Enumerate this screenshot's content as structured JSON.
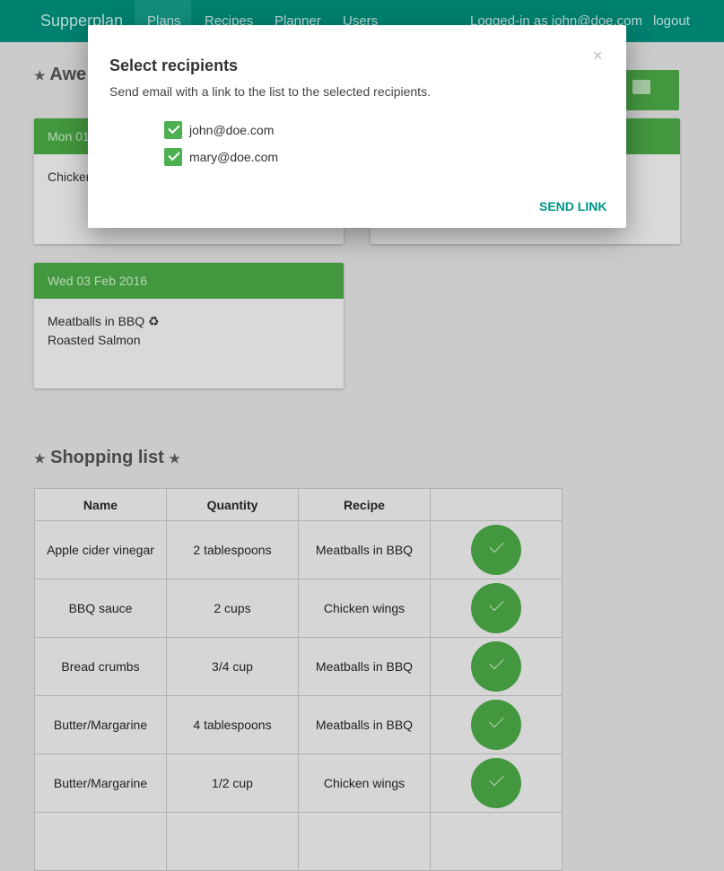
{
  "nav": {
    "brand": "Supperplan",
    "items": [
      "Plans",
      "Recipes",
      "Planner",
      "Users"
    ],
    "active": "Plans",
    "user": "Logged-in as john@doe.com",
    "logout": "logout"
  },
  "plan": {
    "title_visible": "Awe",
    "email_icon": "envelope-icon"
  },
  "cards": [
    {
      "date": "Mon 01",
      "items": [
        "Chicken"
      ]
    },
    {
      "date": "",
      "items": []
    },
    {
      "date": "Wed 03 Feb 2016",
      "items": [
        "Meatballs in BBQ ♻",
        "Roasted Salmon"
      ]
    }
  ],
  "shopping": {
    "title": "Shopping list",
    "columns": [
      "Name",
      "Quantity",
      "Recipe",
      ""
    ],
    "rows": [
      [
        "Apple cider vinegar",
        "2 tablespoons",
        "Meatballs in BBQ"
      ],
      [
        "BBQ sauce",
        "2 cups",
        "Chicken wings"
      ],
      [
        "Bread crumbs",
        "3/4 cup",
        "Meatballs in BBQ"
      ],
      [
        "Butter/Margarine",
        "4 tablespoons",
        "Meatballs in BBQ"
      ],
      [
        "Butter/Margarine",
        "1/2 cup",
        "Chicken wings"
      ]
    ]
  },
  "modal": {
    "title": "Select recipients",
    "close": "×",
    "description": "Send email with a link to the list to the selected recipients.",
    "recipients": [
      {
        "email": "john@doe.com",
        "checked": true
      },
      {
        "email": "mary@doe.com",
        "checked": true
      }
    ],
    "send": "SEND LINK"
  },
  "colors": {
    "navbar": "#00806f",
    "green": "#43973f",
    "accent": "#009688"
  }
}
